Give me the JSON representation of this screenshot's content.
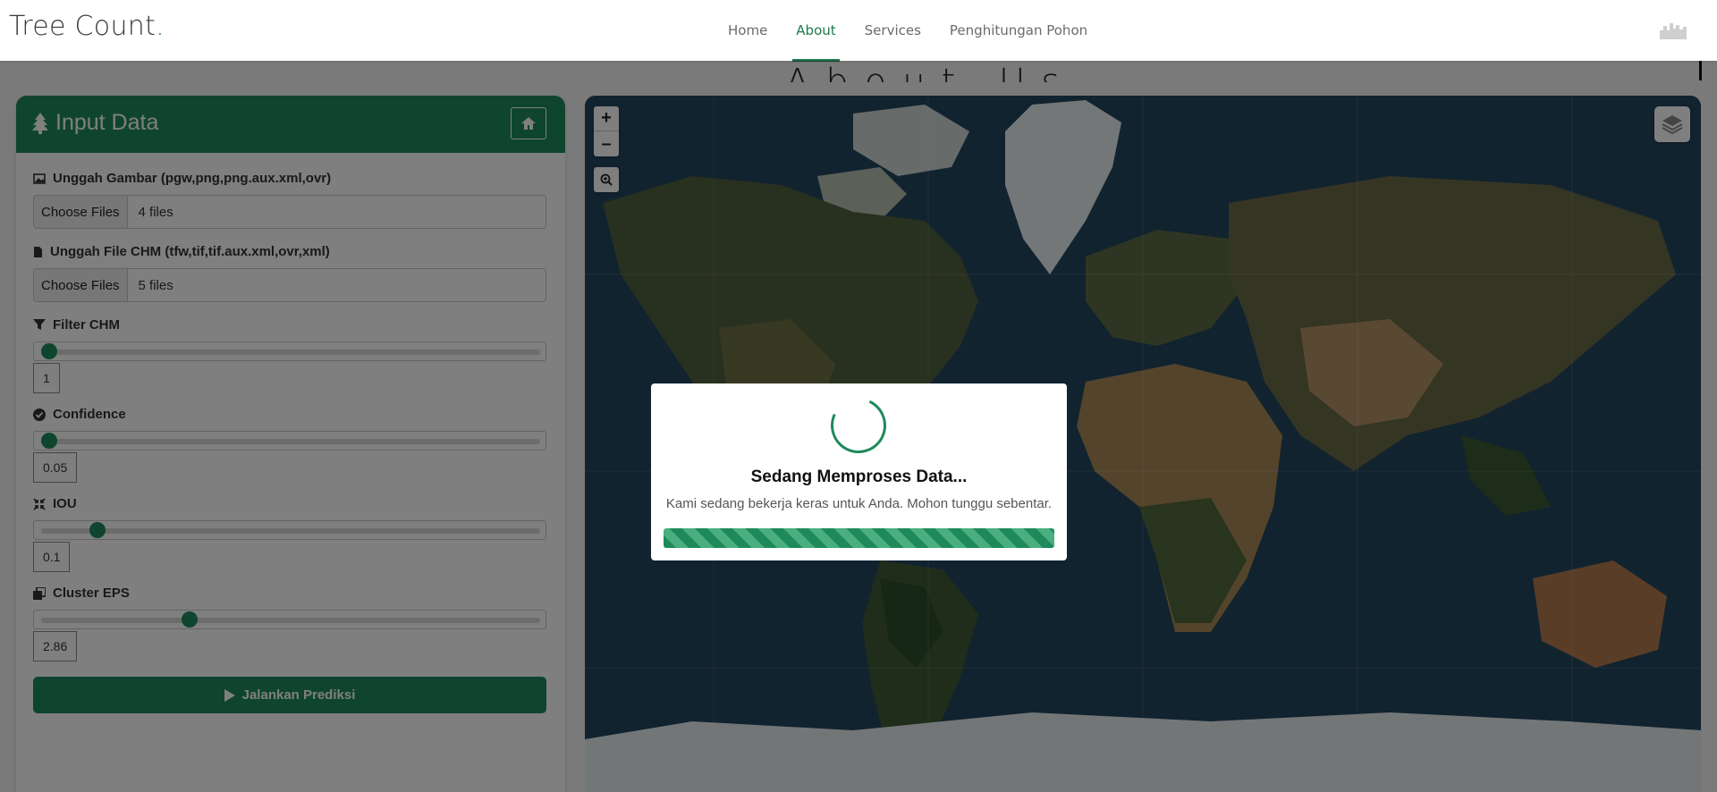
{
  "brand": {
    "name": "Tree Count",
    "dot": "."
  },
  "nav": {
    "links": [
      {
        "label": "Home",
        "active": false
      },
      {
        "label": "About",
        "active": true
      },
      {
        "label": "Services",
        "active": false
      },
      {
        "label": "Penghitungan Pohon",
        "active": false
      }
    ]
  },
  "behind": {
    "title": "About Us"
  },
  "panel": {
    "title": "Input Data",
    "upload_image": {
      "label": "Unggah Gambar (pgw,png,png.aux.xml,ovr)",
      "button": "Choose Files",
      "status": "4 files"
    },
    "upload_chm": {
      "label": "Unggah File CHM (tfw,tif,tif.aux.xml,ovr,xml)",
      "button": "Choose Files",
      "status": "5 files"
    },
    "filter_chm": {
      "label": "Filter CHM",
      "value": "1",
      "level": 0.0
    },
    "confidence": {
      "label": "Confidence",
      "value": "0.05",
      "level": 0.0
    },
    "iou": {
      "label": "IOU",
      "value": "0.1",
      "level": 0.1
    },
    "cluster_eps": {
      "label": "Cluster EPS",
      "value": "2.86",
      "level": 0.29
    },
    "run_button": "Jalankan Prediksi"
  },
  "map": {
    "zoom_in": "+",
    "zoom_out": "–"
  },
  "modal": {
    "title": "Sedang Memproses Data...",
    "message": "Kami sedang bekerja keras untuk Anda. Mohon tunggu sebentar.",
    "progress": 1.0
  },
  "colors": {
    "accent": "#1e8a5c",
    "brand_dot": "#1e7a4d"
  }
}
